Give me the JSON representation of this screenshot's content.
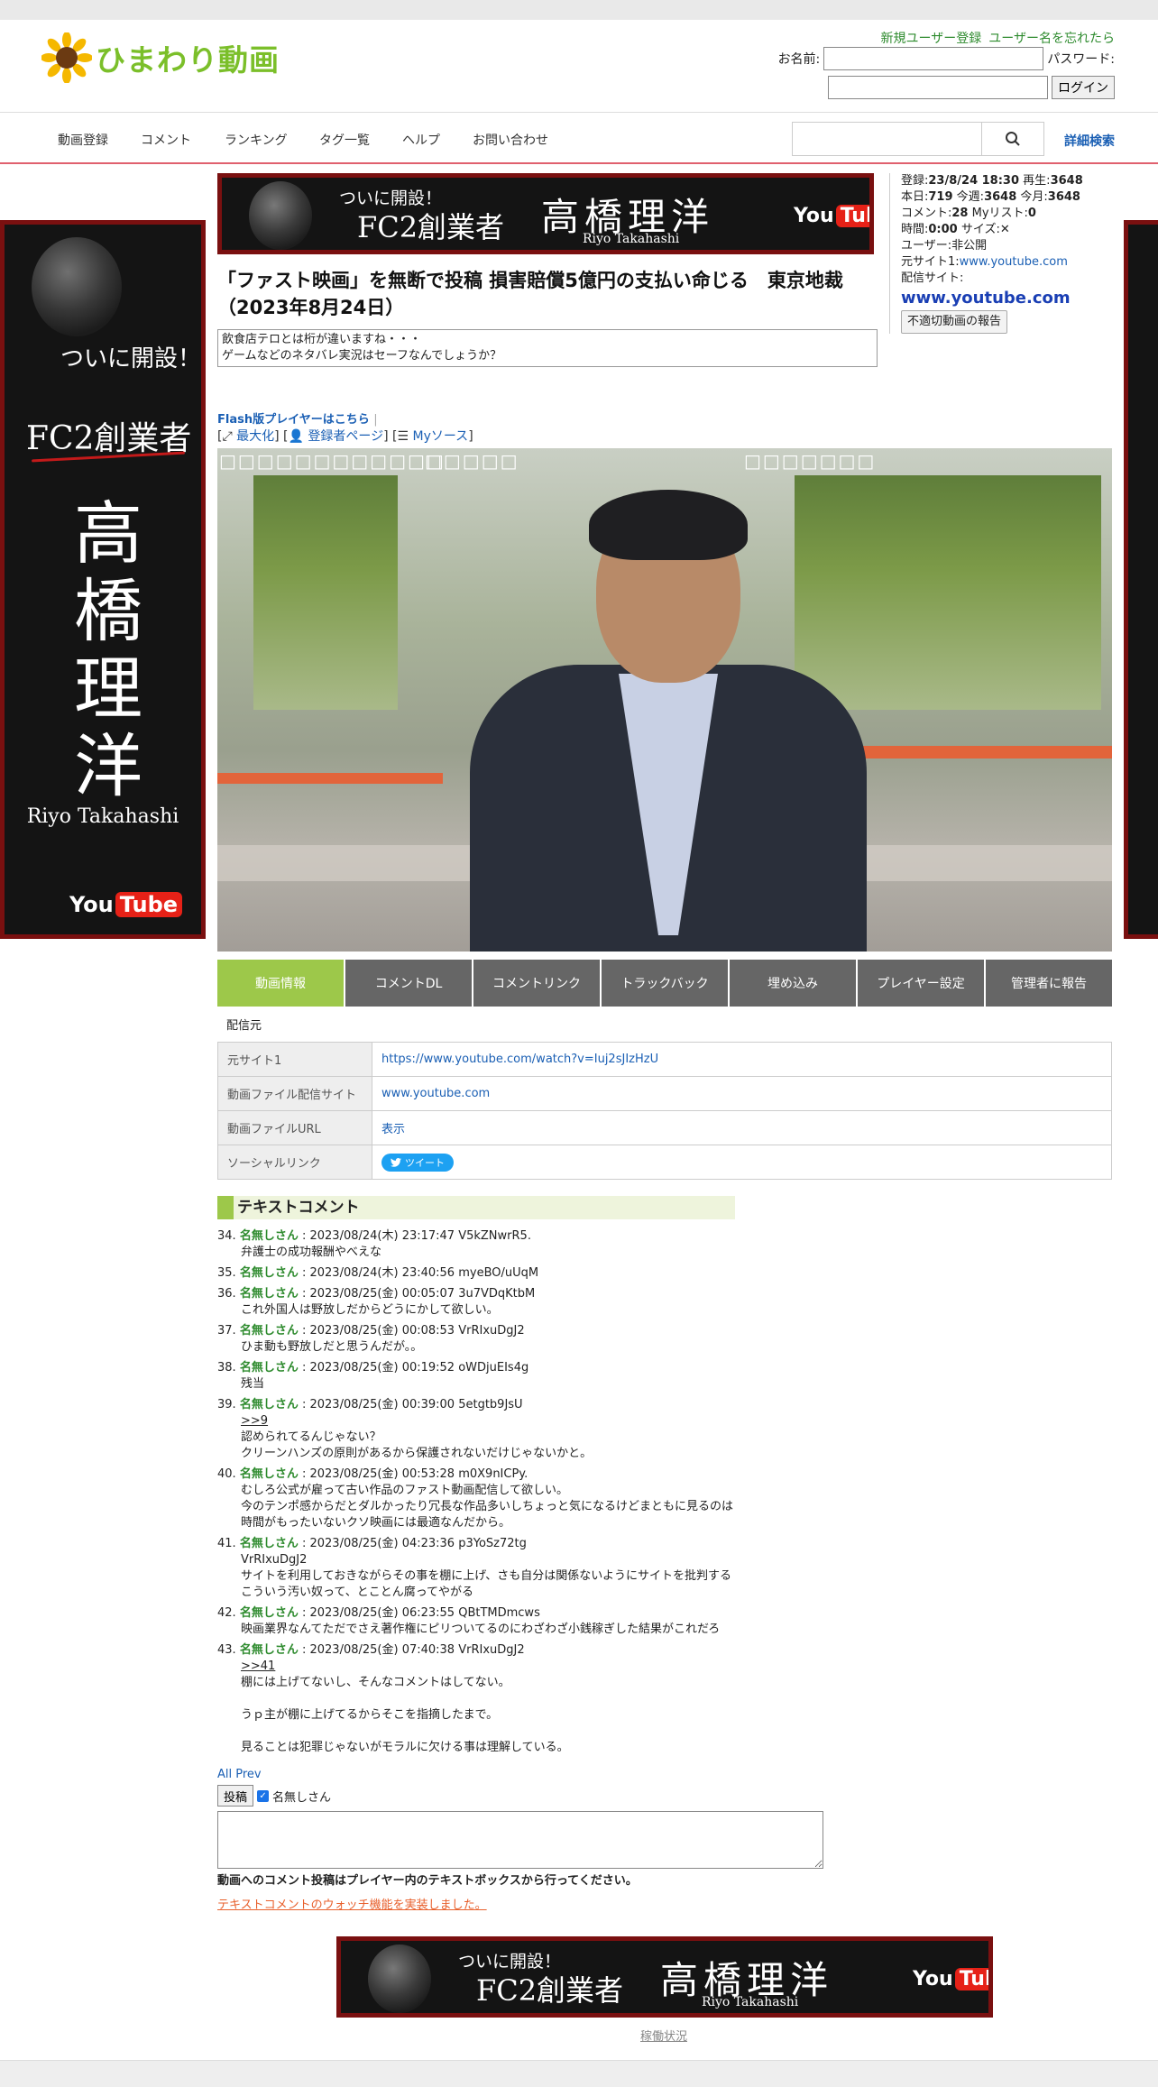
{
  "header": {
    "logo_text": "ひまわり動画",
    "top_links": [
      "新規ユーザー登録",
      "ユーザー名を忘れたら"
    ],
    "name_label": "お名前:",
    "password_label": "パスワード:",
    "login_button": "ログイン"
  },
  "nav": {
    "items": [
      "動画登録",
      "コメント",
      "ランキング",
      "タグ一覧",
      "ヘルプ",
      "お問い合わせ"
    ],
    "search_placeholder": "",
    "advanced_search": "詳細検索"
  },
  "banner": {
    "open": "ついに開設！",
    "company": "FC2創業者",
    "name": "高橋理洋",
    "name_vertical": [
      "高",
      "橋",
      "理",
      "洋"
    ],
    "roman": "Riyo Takahashi",
    "yt_you": "You",
    "yt_tube": "Tube"
  },
  "info": {
    "registered_label": "登録:",
    "registered": "23/8/24 18:30",
    "plays_label": "再生:",
    "plays": "3648",
    "today_label": "本日:",
    "today": "719",
    "this_week_label": "今週:",
    "this_week": "3648",
    "this_month_label": "今月:",
    "this_month": "3648",
    "comments_label": "コメント:",
    "comments": "28",
    "mylist_label": "Myリスト:",
    "mylist": "0",
    "duration_label": "時間:",
    "duration": "0:00",
    "size_label": "サイズ:",
    "size": "✕",
    "user_label": "ユーザー:",
    "user": "非公開",
    "source1_label": "元サイト1:",
    "source1": "www.youtube.com",
    "delivery_label": "配信サイト:",
    "delivery": "www.youtube.com",
    "report_button": "不適切動画の報告"
  },
  "video": {
    "title": "「ファスト映画」を無断で投稿 損害賠償5億円の支払い命じる　東京地裁（2023年8月24日）",
    "description_lines": [
      "飲食店テロとは桁が違いますね・・・",
      "ゲームなどのネタバレ実況はセーフなんでしょうか？"
    ],
    "flash_link": "Flash版プレイヤーはこちら",
    "tool_maximize": "最大化",
    "tool_uploader": "登録者ページ",
    "tool_mysource": "Myソース"
  },
  "tabs": [
    "動画情報",
    "コメントDL",
    "コメントリンク",
    "トラックバック",
    "埋め込み",
    "プレイヤー設定",
    "管理者に報告"
  ],
  "source_section": {
    "label": "配信元",
    "rows": [
      {
        "key": "元サイト1",
        "value": "https://www.youtube.com/watch?v=Iuj2sJIzHzU"
      },
      {
        "key": "動画ファイル配信サイト",
        "value": "www.youtube.com"
      },
      {
        "key": "動画ファイルURL",
        "value": "表示"
      },
      {
        "key": "ソーシャルリンク",
        "value": "ツイート"
      }
    ]
  },
  "comments": {
    "heading": "テキストコメント",
    "items": [
      {
        "no": "34.",
        "name": "名無しさん",
        "meta": " : 2023/08/24(木) 23:17:47 V5kZNwrR5.",
        "lines": [
          "弁護士の成功報酬やべえな"
        ]
      },
      {
        "no": "35.",
        "name": "名無しさん",
        "meta": " : 2023/08/24(木) 23:40:56 myeBO/uUqM",
        "lines": []
      },
      {
        "no": "36.",
        "name": "名無しさん",
        "meta": " : 2023/08/25(金) 00:05:07 3u7VDqKtbM",
        "lines": [
          "これ外国人は野放しだからどうにかして欲しい。"
        ]
      },
      {
        "no": "37.",
        "name": "名無しさん",
        "meta": " : 2023/08/25(金) 00:08:53 VrRIxuDgJ2",
        "lines": [
          "ひま動も野放しだと思うんだが。。"
        ]
      },
      {
        "no": "38.",
        "name": "名無しさん",
        "meta": " : 2023/08/25(金) 00:19:52 oWDjuEIs4g",
        "lines": [
          "残当"
        ]
      },
      {
        "no": "39.",
        "name": "名無しさん",
        "meta": " : 2023/08/25(金) 00:39:00 5etgtb9JsU",
        "anchor": ">>9",
        "lines": [
          "認められてるんじゃない？",
          "クリーンハンズの原則があるから保護されないだけじゃないかと。"
        ]
      },
      {
        "no": "40.",
        "name": "名無しさん",
        "meta": " : 2023/08/25(金) 00:53:28 m0X9nICPy.",
        "lines": [
          "むしろ公式が雇って古い作品のファスト動画配信して欲しい。",
          "今のテンポ感からだとダルかったり冗長な作品多いしちょっと気になるけどまともに見るのは",
          "時間がもったいないクソ映画には最適なんだから。"
        ]
      },
      {
        "no": "41.",
        "name": "名無しさん",
        "meta": " : 2023/08/25(金) 04:23:36 p3YoSz72tg",
        "lines": [
          "VrRIxuDgJ2",
          "サイトを利用しておきながらその事を棚に上げ、さも自分は関係ないようにサイトを批判する",
          "こういう汚い奴って、とことん腐ってやがる"
        ]
      },
      {
        "no": "42.",
        "name": "名無しさん",
        "meta": " : 2023/08/25(金) 06:23:55 QBtTMDmcws",
        "lines": [
          "映画業界なんてただでさえ著作権にピリついてるのにわざわざ小銭稼ぎした結果がこれだろ"
        ]
      },
      {
        "no": "43.",
        "name": "名無しさん",
        "meta": " : 2023/08/25(金) 07:40:38 VrRIxuDgJ2",
        "anchor": ">>41",
        "lines": [
          "棚には上げてないし、そんなコメントはしてない。",
          "",
          "うｐ主が棚に上げてるからそこを指摘したまで。",
          "",
          "見ることは犯罪じゃないがモラルに欠ける事は理解している。"
        ]
      }
    ],
    "all_prev": "All Prev",
    "post_button": "投稿",
    "anon_label": "名無しさん",
    "note": "動画へのコメント投稿はプレイヤー内のテキストボックスから行ってください。",
    "watch_link": "テキストコメントのウォッチ機能を実装しました。"
  },
  "footer": {
    "status_link": "稼働状況"
  },
  "colors": {
    "accent_green": "#9dc84a",
    "nav_red_line": "#e0606e",
    "link_blue": "#1a5fb4",
    "banner_border": "#7a1010"
  }
}
